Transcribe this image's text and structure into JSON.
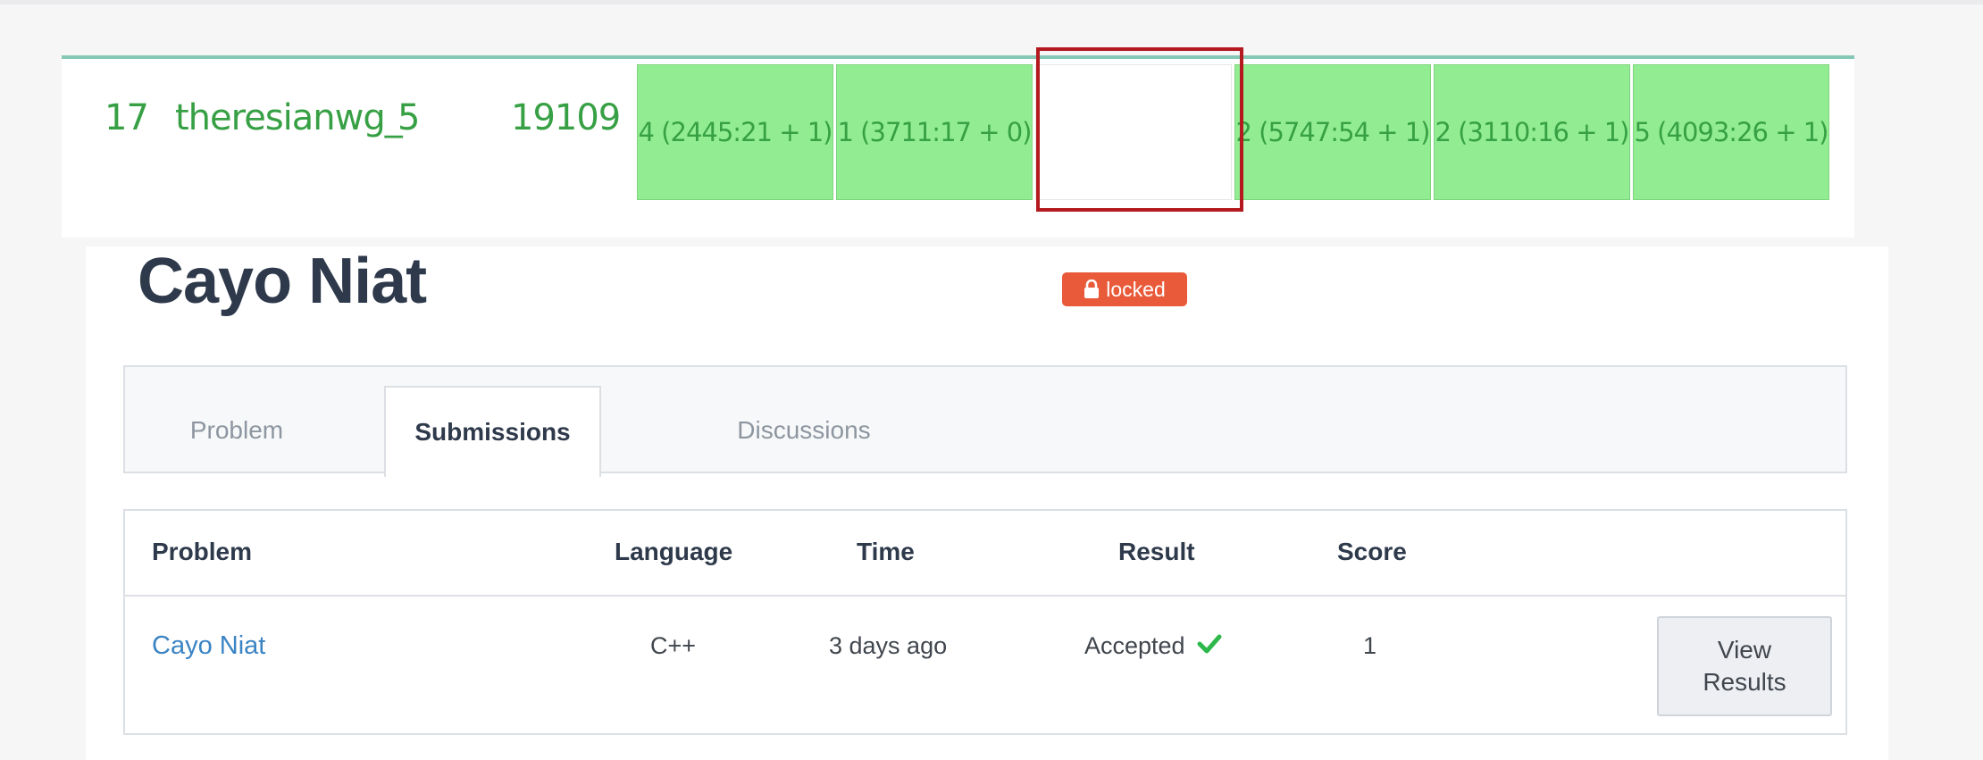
{
  "leaderboard": {
    "rank": "17",
    "username": "theresianwg_",
    "solved": "5",
    "penalty": "19109",
    "cells": [
      "4 (2445:21 + 1)",
      "1 (3711:17 + 0)",
      "",
      "2 (5747:54 + 1)",
      "2 (3110:16 + 1)",
      "5 (4093:26 + 1)"
    ]
  },
  "problem": {
    "title": "Cayo Niat",
    "badge": "locked"
  },
  "tabs": [
    "Problem",
    "Submissions",
    "Discussions"
  ],
  "active_tab": "Submissions",
  "table": {
    "headers": [
      "Problem",
      "Language",
      "Time",
      "Result",
      "Score"
    ],
    "row": {
      "problem": "Cayo Niat",
      "language": "C++",
      "time": "3 days ago",
      "result": "Accepted",
      "score": "1",
      "action": "View\nResults"
    }
  },
  "colors": {
    "accent_green": "#37a044",
    "cell_green": "#92ed92",
    "highlight_red": "#b3191e",
    "badge_red": "#e95a3a",
    "link_blue": "#3b84c4",
    "check_green": "#2eb84b"
  }
}
